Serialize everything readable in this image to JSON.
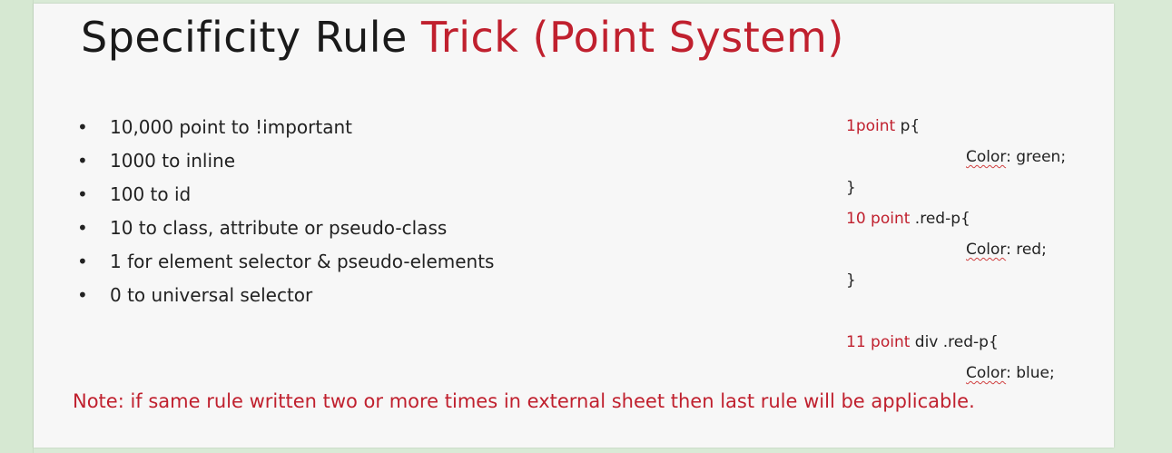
{
  "slide": {
    "title_main": "Specificity Rule ",
    "title_accent": "Trick (Point System)",
    "bullets": [
      "10,000 point to !important",
      "1000 to inline",
      "100 to id",
      "10 to class, attribute or pseudo-class",
      "1 for element selector & pseudo-elements",
      "0 to universal selector"
    ],
    "bullet_glyph": "•",
    "code": {
      "block1_points": "1point",
      "block1_selector": " p{",
      "block1_prop": "Color",
      "block1_value": ": green;",
      "block1_close": "}",
      "block2_points": "10 point",
      "block2_selector": " .red-p{",
      "block2_prop": "Color",
      "block2_value": ": red;",
      "block2_close": "}",
      "block3_points": "11 point",
      "block3_selector": " div .red-p{",
      "block3_prop": "Color",
      "block3_value": ": blue;"
    },
    "note": "Note: if same rule written two or more times in external sheet then last rule will be applicable."
  },
  "colors": {
    "accent": "#c0202e",
    "text": "#222222",
    "background": "#d9ead6",
    "slide": "#f7f7f7"
  }
}
